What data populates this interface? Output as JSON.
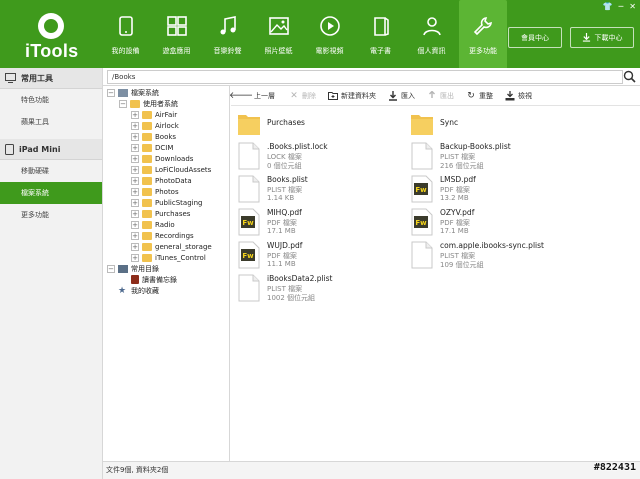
{
  "app": {
    "name": "iTools"
  },
  "window_controls": {
    "shirt": "👕",
    "minimize": "─",
    "close": "✕"
  },
  "nav": [
    {
      "label": "我的設備",
      "icon": "device-icon"
    },
    {
      "label": "遊盒應用",
      "icon": "apps-grid-icon"
    },
    {
      "label": "音樂鈴聲",
      "icon": "music-note-icon"
    },
    {
      "label": "照片壁紙",
      "icon": "photo-icon"
    },
    {
      "label": "電影視頻",
      "icon": "play-icon"
    },
    {
      "label": "電子書",
      "icon": "book-icon"
    },
    {
      "label": "個人資訊",
      "icon": "person-icon"
    },
    {
      "label": "更多功能",
      "icon": "wrench-icon",
      "active": true
    }
  ],
  "header_buttons": {
    "member": "會員中心",
    "download": "下載中心"
  },
  "sidebar": {
    "groups": [
      {
        "label": "常用工具",
        "items": [
          "特色功能",
          "蘋果工具"
        ]
      },
      {
        "label": "iPad Mini",
        "items": [
          "移動硬碟",
          "檔案系統",
          "更多功能"
        ]
      }
    ],
    "active_item": "檔案系統"
  },
  "path": {
    "value": "/Books"
  },
  "tree": {
    "root": "檔案系統",
    "user_system": "使用者系統",
    "folders": [
      "AirFair",
      "Airlock",
      "Books",
      "DCIM",
      "Downloads",
      "LoFiCloudAssets",
      "PhotoData",
      "Photos",
      "PublicStaging",
      "Purchases",
      "Radio",
      "Recordings",
      "general_storage",
      "iTunes_Control"
    ],
    "recent": "常用目錄",
    "recent_child": "讀書備忘錄",
    "favorites": "我的收藏"
  },
  "toolbar": {
    "up": "上一層",
    "delete": "刪除",
    "new_folder": "新建資料夾",
    "import": "匯入",
    "export": "匯出",
    "refresh": "重整",
    "view": "檢視"
  },
  "files": [
    {
      "name": "Purchases",
      "type": "",
      "size": "",
      "icon": "folder"
    },
    {
      "name": "Sync",
      "type": "",
      "size": "",
      "icon": "folder"
    },
    {
      "name": ".Books.plist.lock",
      "type": "LOCK 檔案",
      "size": "0 個位元組",
      "icon": "doc"
    },
    {
      "name": "Backup-Books.plist",
      "type": "PLIST 檔案",
      "size": "216 個位元組",
      "icon": "doc"
    },
    {
      "name": "Books.plist",
      "type": "PLIST 檔案",
      "size": "1.14 KB",
      "icon": "doc"
    },
    {
      "name": "LMSD.pdf",
      "type": "PDF 檔案",
      "size": "13.2 MB",
      "icon": "pdf"
    },
    {
      "name": "MIHQ.pdf",
      "type": "PDF 檔案",
      "size": "17.1 MB",
      "icon": "pdf"
    },
    {
      "name": "OZYV.pdf",
      "type": "PDF 檔案",
      "size": "17.1 MB",
      "icon": "pdf"
    },
    {
      "name": "WUJD.pdf",
      "type": "PDF 檔案",
      "size": "11.1 MB",
      "icon": "pdf"
    },
    {
      "name": "com.apple.ibooks-sync.plist",
      "type": "PLIST 檔案",
      "size": "109 個位元組",
      "icon": "doc"
    },
    {
      "name": "iBooksData2.plist",
      "type": "PLIST 檔案",
      "size": "1002 個位元組",
      "icon": "doc"
    }
  ],
  "pdf_icon_text": "Fw",
  "status": {
    "text": "文件9個, 資料夾2個"
  },
  "watermark": "#822431",
  "colors": {
    "brand_green": "#3f9a1c",
    "active_nav": "#5cb534",
    "folder": "#f1c24e"
  }
}
